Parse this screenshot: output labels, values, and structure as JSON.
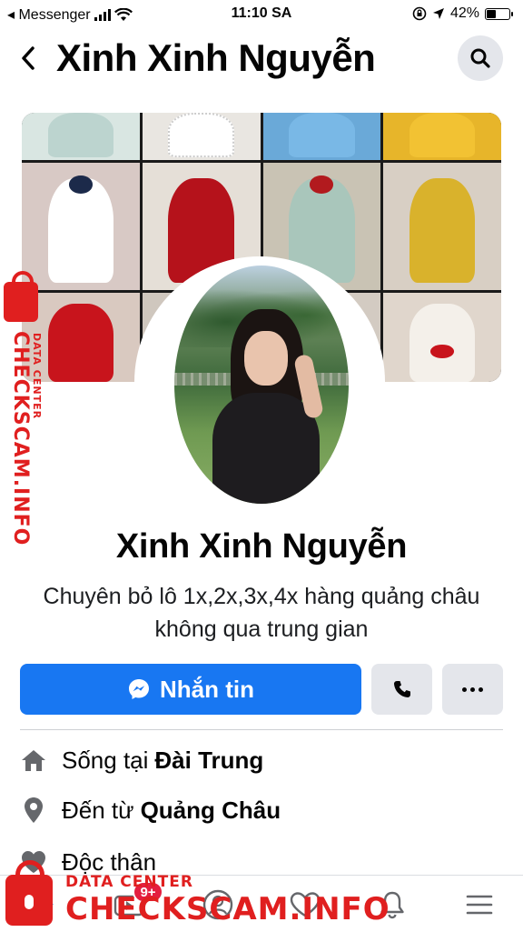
{
  "status_bar": {
    "back_app": "◂ Messenger",
    "time": "11:10 SA",
    "battery": "42%",
    "battery_level": 0.42
  },
  "header": {
    "title": "Xinh Xinh Nguyễn",
    "back_icon": "chevron-left-icon",
    "search_icon": "search-icon"
  },
  "profile": {
    "name": "Xinh Xinh Nguyễn",
    "bio": "Chuyên bỏ lô 1x,2x,3x,4x hàng quảng châu không qua trung gian"
  },
  "actions": {
    "message_label": "Nhắn tin",
    "message_icon": "messenger-icon",
    "call_icon": "phone-icon",
    "more_icon": "more-icon"
  },
  "info": [
    {
      "icon": "home-icon",
      "prefix": "Sống tại",
      "value": "Đài Trung"
    },
    {
      "icon": "location-pin-icon",
      "prefix": "Đến từ",
      "value": "Quảng Châu"
    },
    {
      "icon": "heart-icon",
      "prefix": "Độc thân",
      "value": ""
    }
  ],
  "bottom_nav": {
    "badge": "9+",
    "items": [
      "home-icon",
      "video-icon",
      "profile-icon",
      "dating-icon",
      "bell-icon",
      "menu-icon"
    ]
  },
  "watermark": {
    "vertical_text": "CHECKSCAM.INFO",
    "vertical_sub": "DATA CENTER",
    "bottom_sub": "DATA CENTER",
    "bottom_text": "CHECKSCAM.INFO"
  },
  "colors": {
    "accent": "#1877f2",
    "badge": "#e41e3f",
    "watermark": "#e01f1f"
  }
}
